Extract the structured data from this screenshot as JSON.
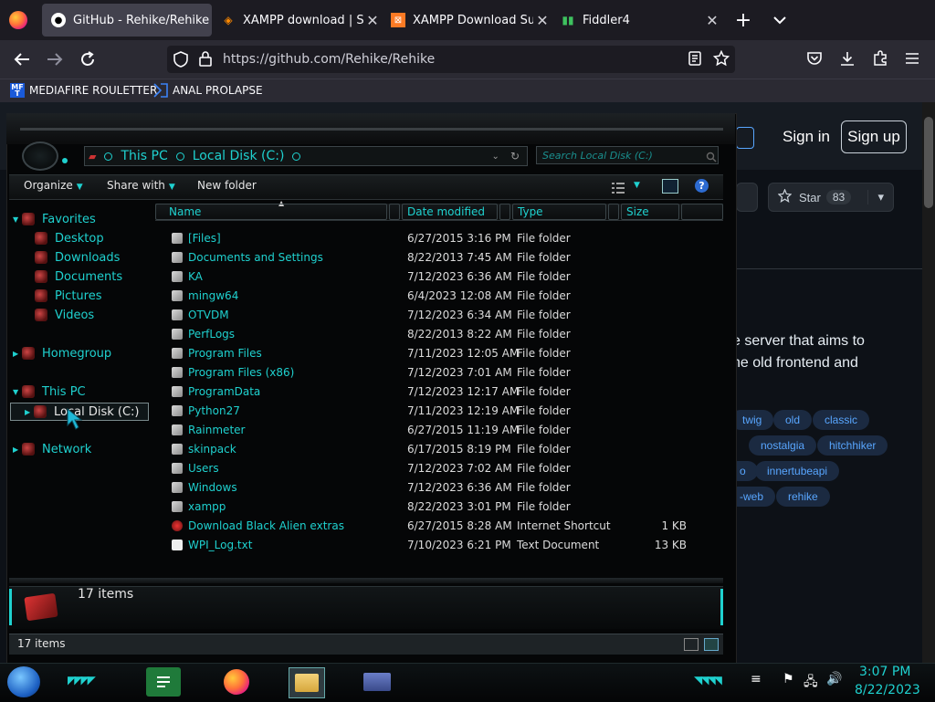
{
  "browser": {
    "tabs": [
      {
        "title": "GitHub - Rehike/Rehike",
        "active": true
      },
      {
        "title": "XAMPP download | SourceForge",
        "active": false
      },
      {
        "title": "XAMPP Download Success",
        "active": false
      },
      {
        "title": "Fiddler4",
        "active": false
      }
    ],
    "new_tab": "+",
    "url": "https://github.com/Rehike/Rehike",
    "bookmarks": [
      {
        "label": "MEDIAFIRE ROULETTER",
        "icon_text": "MF T"
      },
      {
        "label": "ANAL PROLAPSE"
      }
    ]
  },
  "github": {
    "sign_in": "Sign in",
    "sign_up": "Sign up",
    "star_label": "Star",
    "star_count": "83",
    "desc_line1": "e server that aims to",
    "desc_line2": "he old frontend and",
    "topics": [
      "twig",
      "old",
      "classic",
      "nostalgia",
      "hitchhiker",
      "o",
      "innertubeapi",
      "-web",
      "rehike"
    ]
  },
  "explorer": {
    "breadcrumb": [
      "This PC",
      "Local Disk (C:)"
    ],
    "search_placeholder": "Search Local Disk (C:)",
    "toolbar": {
      "organize": "Organize",
      "share_with": "Share with",
      "new_folder": "New folder",
      "help": "?"
    },
    "nav": {
      "favorites": "Favorites",
      "favorites_items": [
        "Desktop",
        "Downloads",
        "Documents",
        "Pictures",
        "Videos"
      ],
      "homegroup": "Homegroup",
      "this_pc": "This PC",
      "local_disk": "Local Disk (C:)",
      "network": "Network"
    },
    "columns": {
      "name": "Name",
      "date": "Date modified",
      "type": "Type",
      "size": "Size"
    },
    "files": [
      {
        "name": "[Files]",
        "date": "6/27/2015 3:16 PM",
        "type": "File folder",
        "size": ""
      },
      {
        "name": "Documents and Settings",
        "date": "8/22/2013 7:45 AM",
        "type": "File folder",
        "size": ""
      },
      {
        "name": "KA",
        "date": "7/12/2023 6:36 AM",
        "type": "File folder",
        "size": ""
      },
      {
        "name": "mingw64",
        "date": "6/4/2023 12:08 AM",
        "type": "File folder",
        "size": ""
      },
      {
        "name": "OTVDM",
        "date": "7/12/2023 6:34 AM",
        "type": "File folder",
        "size": ""
      },
      {
        "name": "PerfLogs",
        "date": "8/22/2013 8:22 AM",
        "type": "File folder",
        "size": ""
      },
      {
        "name": "Program Files",
        "date": "7/11/2023 12:05 AM",
        "type": "File folder",
        "size": ""
      },
      {
        "name": "Program Files (x86)",
        "date": "7/12/2023 7:01 AM",
        "type": "File folder",
        "size": ""
      },
      {
        "name": "ProgramData",
        "date": "7/12/2023 12:17 AM",
        "type": "File folder",
        "size": ""
      },
      {
        "name": "Python27",
        "date": "7/11/2023 12:19 AM",
        "type": "File folder",
        "size": ""
      },
      {
        "name": "Rainmeter",
        "date": "6/27/2015 11:19 AM",
        "type": "File folder",
        "size": ""
      },
      {
        "name": "skinpack",
        "date": "6/17/2015 8:19 PM",
        "type": "File folder",
        "size": ""
      },
      {
        "name": "Users",
        "date": "7/12/2023 7:02 AM",
        "type": "File folder",
        "size": ""
      },
      {
        "name": "Windows",
        "date": "7/12/2023 6:36 AM",
        "type": "File folder",
        "size": ""
      },
      {
        "name": "xampp",
        "date": "8/22/2023 3:01 PM",
        "type": "File folder",
        "size": ""
      },
      {
        "name": "Download Black Alien extras",
        "date": "6/27/2015 8:28 AM",
        "type": "Internet Shortcut",
        "size": "1 KB"
      },
      {
        "name": "WPI_Log.txt",
        "date": "7/10/2023 6:21 PM",
        "type": "Text Document",
        "size": "13 KB"
      }
    ],
    "details_count": "17 items",
    "status_count": "17 items"
  },
  "taskbar": {
    "time": "3:07 PM",
    "date": "8/22/2023"
  },
  "colors": {
    "accent": "#1fd1cf",
    "github_link": "#58a6ff"
  }
}
